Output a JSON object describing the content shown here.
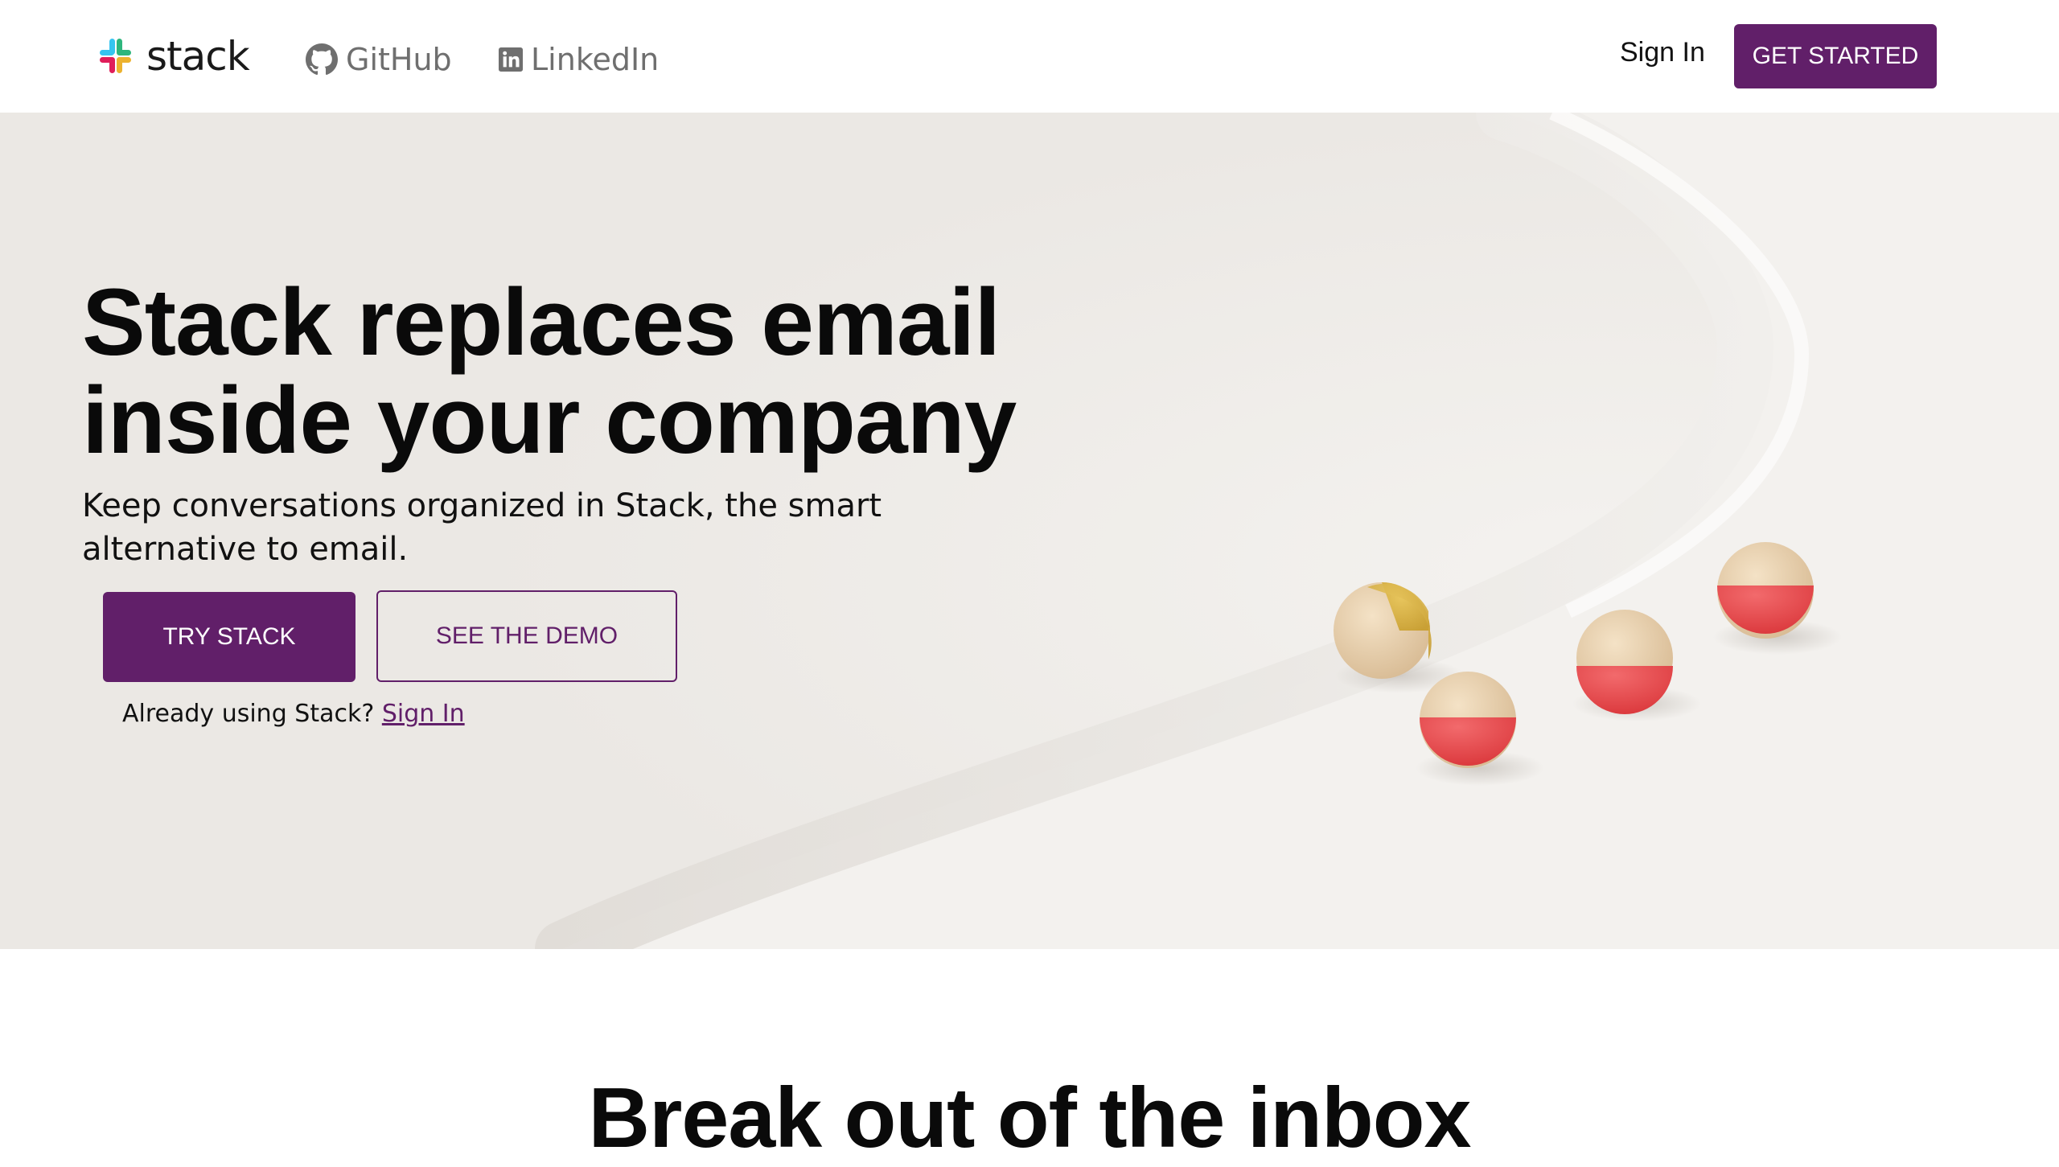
{
  "header": {
    "brand": "stack",
    "nav": [
      {
        "label": "GitHub",
        "icon": "github-icon"
      },
      {
        "label": "LinkedIn",
        "icon": "linkedin-icon"
      }
    ],
    "sign_in": "Sign In",
    "cta": "GET STARTED"
  },
  "hero": {
    "title_line1": "Stack replaces email",
    "title_line2": "inside your company",
    "subtitle": "Keep conversations organized in Stack, the smart alternative to email.",
    "primary_button": "TRY STACK",
    "secondary_button": "SEE THE DEMO",
    "already_text": "Already using Stack?",
    "already_link": "Sign In"
  },
  "section": {
    "title": "Break out of the inbox"
  },
  "colors": {
    "brand_purple": "#611f69",
    "hero_bg": "#ebe8e4",
    "ball_red": "#e8474a",
    "ball_yellow": "#d9b447",
    "logo_blue": "#36c5f0",
    "logo_green": "#2eb67d",
    "logo_yellow": "#ecb22e",
    "logo_red": "#e01e5a"
  }
}
